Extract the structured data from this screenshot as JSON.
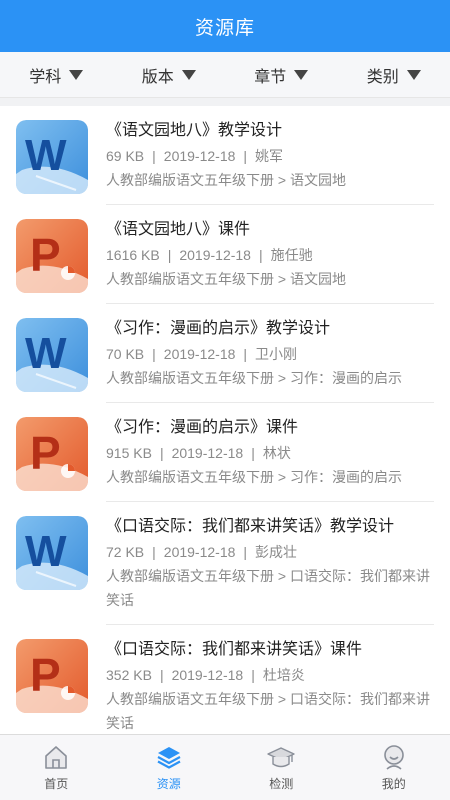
{
  "header": {
    "title": "资源库"
  },
  "filters": [
    {
      "label": "学科"
    },
    {
      "label": "版本"
    },
    {
      "label": "章节"
    },
    {
      "label": "类别"
    }
  ],
  "resources": [
    {
      "type": "word",
      "title": "《语文园地八》教学设计",
      "size": "69 KB",
      "date": "2019-12-18",
      "author": "姚军",
      "path": "人教部编版语文五年级下册 > 语文园地"
    },
    {
      "type": "ppt",
      "title": "《语文园地八》课件",
      "size": "1616 KB",
      "date": "2019-12-18",
      "author": "施任驰",
      "path": "人教部编版语文五年级下册 > 语文园地"
    },
    {
      "type": "word",
      "title": "《习作：漫画的启示》教学设计",
      "size": "70 KB",
      "date": "2019-12-18",
      "author": "卫小刚",
      "path": "人教部编版语文五年级下册 > 习作：漫画的启示"
    },
    {
      "type": "ppt",
      "title": "《习作：漫画的启示》课件",
      "size": "915 KB",
      "date": "2019-12-18",
      "author": "林状",
      "path": "人教部编版语文五年级下册 > 习作：漫画的启示"
    },
    {
      "type": "word",
      "title": "《口语交际：我们都来讲笑话》教学设计",
      "size": "72 KB",
      "date": "2019-12-18",
      "author": "彭成壮",
      "path": "人教部编版语文五年级下册 > 口语交际：我们都来讲笑话"
    },
    {
      "type": "ppt",
      "title": "《口语交际：我们都来讲笑话》课件",
      "size": "352 KB",
      "date": "2019-12-18",
      "author": "杜培炎",
      "path": "人教部编版语文五年级下册 > 口语交际：我们都来讲笑话"
    }
  ],
  "tabbar": [
    {
      "label": "首页",
      "icon": "home-icon",
      "active": false
    },
    {
      "label": "资源",
      "icon": "layers-icon",
      "active": true
    },
    {
      "label": "检测",
      "icon": "graduation-cap-icon",
      "active": false
    },
    {
      "label": "我的",
      "icon": "user-icon",
      "active": false
    }
  ],
  "colors": {
    "accent": "#2b92f5",
    "word": "#1f6fc6",
    "ppt": "#e3562e"
  }
}
